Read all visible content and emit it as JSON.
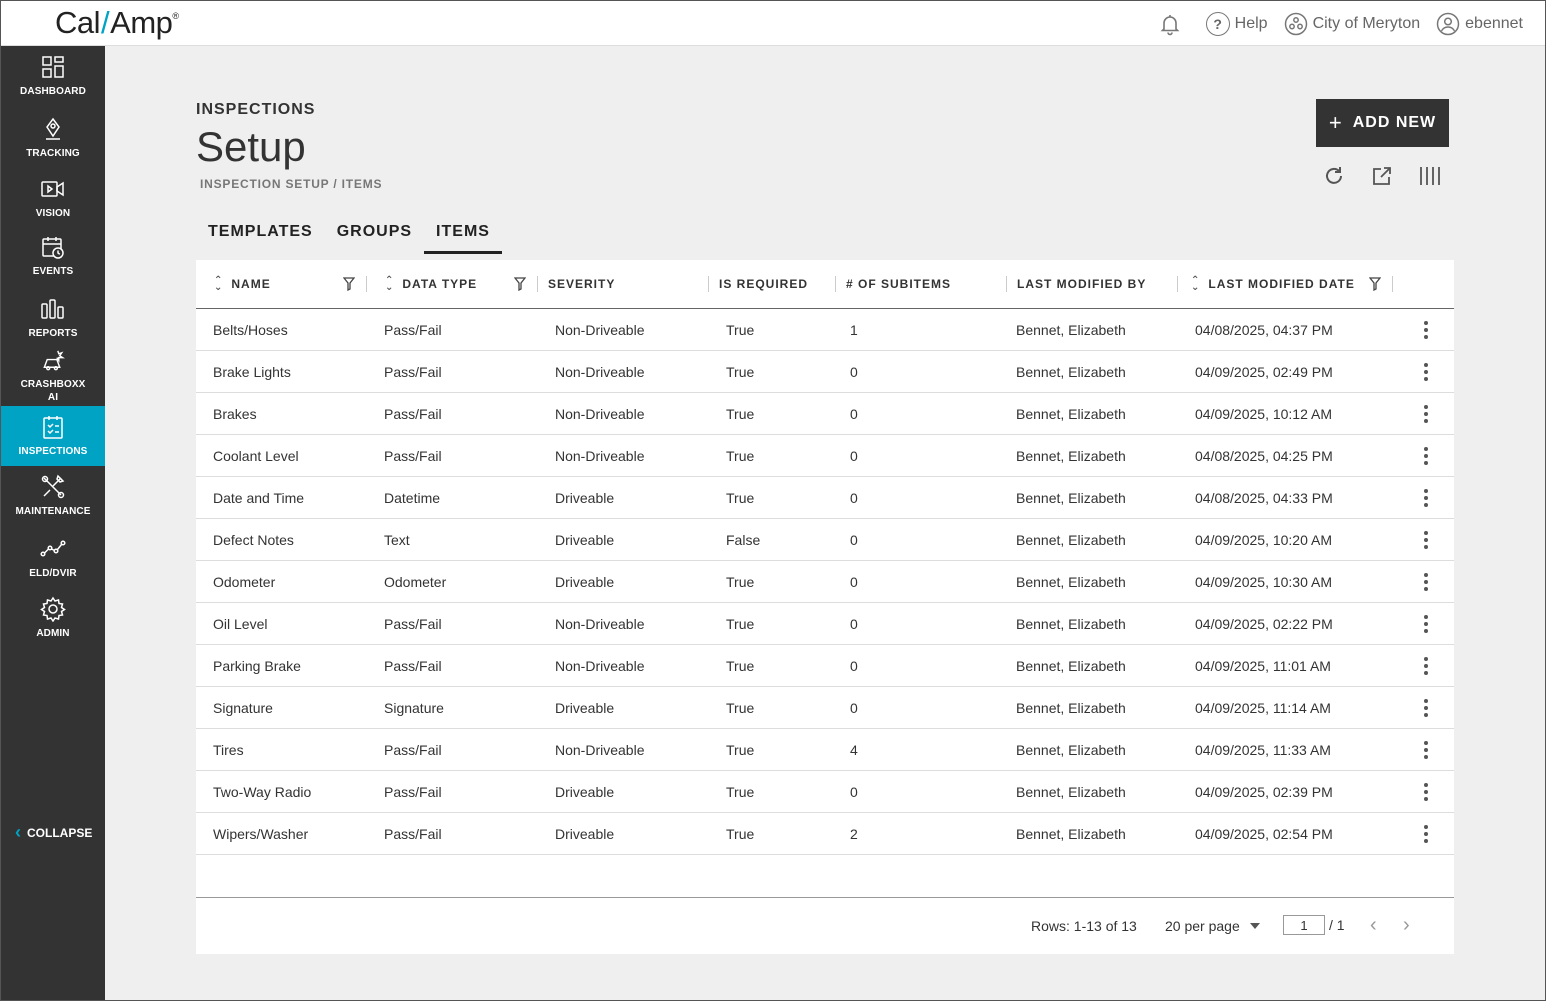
{
  "brand": {
    "logo_left": "Cal",
    "logo_right": "Amp",
    "logo_tm": "®"
  },
  "topbar": {
    "help_label": "Help",
    "org_label": "City of Meryton",
    "user_label": "ebennet"
  },
  "sidebar": {
    "items": [
      {
        "label": "DASHBOARD",
        "icon": "dashboard-icon"
      },
      {
        "label": "TRACKING",
        "icon": "tracking-icon"
      },
      {
        "label": "VISION",
        "icon": "video-icon"
      },
      {
        "label": "EVENTS",
        "icon": "events-icon"
      },
      {
        "label": "REPORTS",
        "icon": "reports-icon"
      },
      {
        "label": "CRASHBOXX AI",
        "icon": "crashboxx-icon"
      },
      {
        "label": "INSPECTIONS",
        "icon": "inspections-icon"
      },
      {
        "label": "MAINTENANCE",
        "icon": "maintenance-icon"
      },
      {
        "label": "ELD/DVIR",
        "icon": "eld-icon"
      },
      {
        "label": "ADMIN",
        "icon": "gear-icon"
      }
    ],
    "active": "INSPECTIONS",
    "collapse_label": "COLLAPSE"
  },
  "header": {
    "section": "INSPECTIONS",
    "title": "Setup",
    "breadcrumb": "INSPECTION SETUP / ITEMS",
    "add_label": "ADD NEW"
  },
  "tabs": [
    {
      "label": "TEMPLATES",
      "active": false
    },
    {
      "label": "GROUPS",
      "active": false
    },
    {
      "label": "ITEMS",
      "active": true
    }
  ],
  "table": {
    "columns": [
      "NAME",
      "DATA TYPE",
      "SEVERITY",
      "IS REQUIRED",
      "# OF SUBITEMS",
      "LAST MODIFIED BY",
      "LAST MODIFIED DATE"
    ],
    "rows": [
      [
        "Belts/Hoses",
        "Pass/Fail",
        "Non-Driveable",
        "True",
        "1",
        "Bennet, Elizabeth",
        "04/08/2025, 04:37 PM"
      ],
      [
        "Brake Lights",
        "Pass/Fail",
        "Non-Driveable",
        "True",
        "0",
        "Bennet, Elizabeth",
        "04/09/2025, 02:49 PM"
      ],
      [
        "Brakes",
        "Pass/Fail",
        "Non-Driveable",
        "True",
        "0",
        "Bennet, Elizabeth",
        "04/09/2025, 10:12 AM"
      ],
      [
        "Coolant Level",
        "Pass/Fail",
        "Non-Driveable",
        "True",
        "0",
        "Bennet, Elizabeth",
        "04/08/2025, 04:25 PM"
      ],
      [
        "Date and Time",
        "Datetime",
        "Driveable",
        "True",
        "0",
        "Bennet, Elizabeth",
        "04/08/2025, 04:33 PM"
      ],
      [
        "Defect Notes",
        "Text",
        "Driveable",
        "False",
        "0",
        "Bennet, Elizabeth",
        "04/09/2025, 10:20 AM"
      ],
      [
        "Odometer",
        "Odometer",
        "Driveable",
        "True",
        "0",
        "Bennet, Elizabeth",
        "04/09/2025, 10:30 AM"
      ],
      [
        "Oil Level",
        "Pass/Fail",
        "Non-Driveable",
        "True",
        "0",
        "Bennet, Elizabeth",
        "04/09/2025, 02:22 PM"
      ],
      [
        "Parking Brake",
        "Pass/Fail",
        "Non-Driveable",
        "True",
        "0",
        "Bennet, Elizabeth",
        "04/09/2025, 11:01 AM"
      ],
      [
        "Signature",
        "Signature",
        "Driveable",
        "True",
        "0",
        "Bennet, Elizabeth",
        "04/09/2025, 11:14 AM"
      ],
      [
        "Tires",
        "Pass/Fail",
        "Non-Driveable",
        "True",
        "4",
        "Bennet, Elizabeth",
        "04/09/2025, 11:33 AM"
      ],
      [
        "Two-Way Radio",
        "Pass/Fail",
        "Driveable",
        "True",
        "0",
        "Bennet, Elizabeth",
        "04/09/2025, 02:39 PM"
      ],
      [
        "Wipers/Washer",
        "Pass/Fail",
        "Driveable",
        "True",
        "2",
        "Bennet, Elizabeth",
        "04/09/2025, 02:54 PM"
      ]
    ]
  },
  "pagination": {
    "rows_info": "Rows: 1-13 of 13",
    "per_page": "20 per page",
    "current_page": "1",
    "total_pages": "/ 1"
  },
  "colors": {
    "accent": "#00a3c4",
    "sidebar": "#333333",
    "button": "#333333"
  }
}
